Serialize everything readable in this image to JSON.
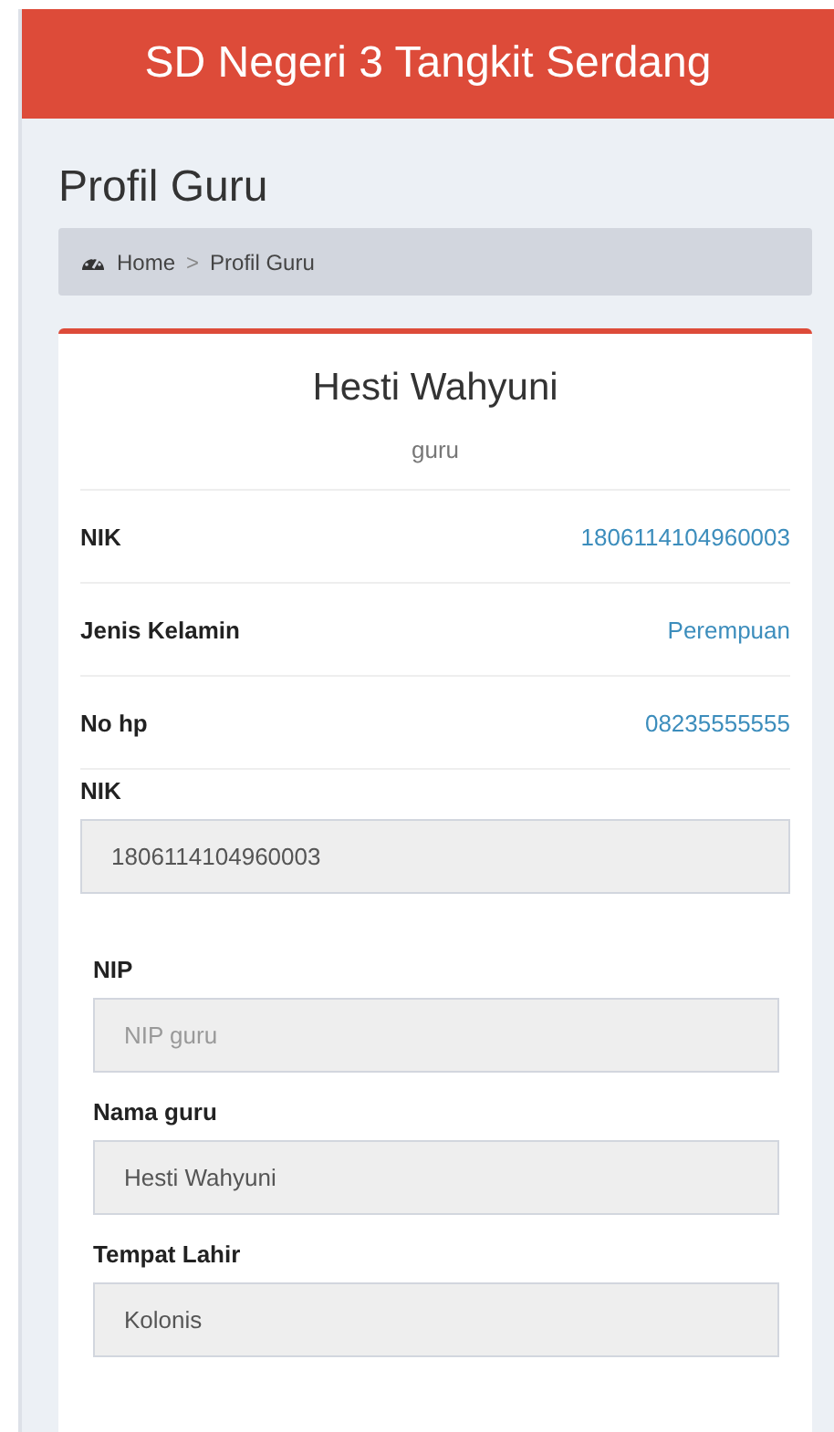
{
  "header": {
    "title": "SD Negeri 3 Tangkit Serdang"
  },
  "page_title": "Profil Guru",
  "breadcrumb": [
    {
      "label": "Home",
      "kind": "home"
    },
    {
      "label": ">",
      "kind": "separator"
    },
    {
      "label": "Profil Guru",
      "kind": "current"
    }
  ],
  "profile": {
    "name": "Hesti Wahyuni",
    "role": "guru",
    "details": [
      {
        "label": "NIK",
        "value": "1806114104960003"
      },
      {
        "label": "Jenis Kelamin",
        "value": "Perempuan"
      },
      {
        "label": "No hp",
        "value": "08235555555"
      }
    ]
  },
  "nik_field": {
    "label": "NIK",
    "value": "1806114104960003"
  },
  "form": {
    "fields": [
      {
        "label": "NIP",
        "placeholder": "NIP guru"
      },
      {
        "label": "Nama guru",
        "value": "Hesti Wahyuni"
      },
      {
        "label": "Tempat Lahir",
        "value": "Kolonis"
      }
    ]
  }
}
